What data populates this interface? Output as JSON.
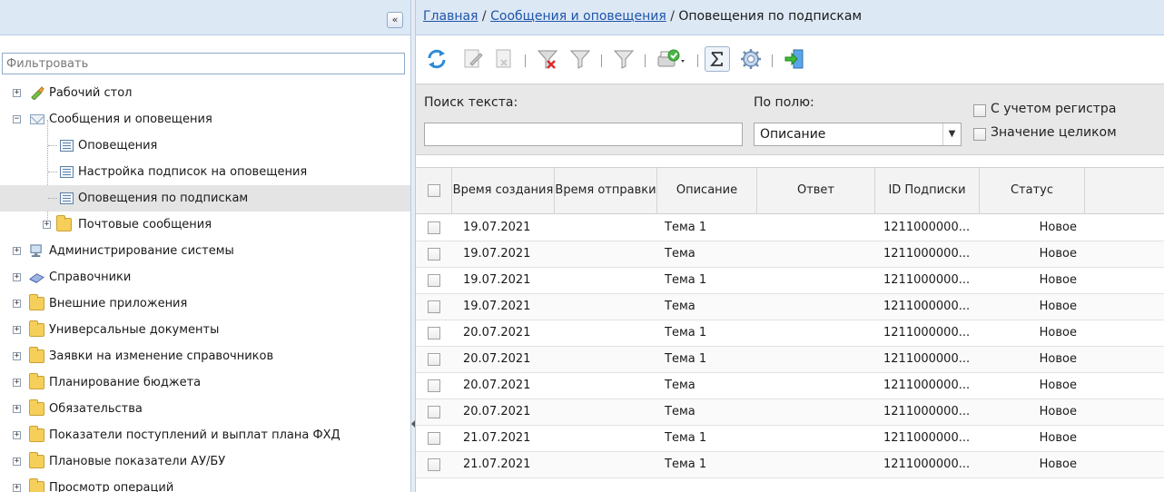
{
  "left_panel": {
    "collapse_label": "«",
    "filter_placeholder": "Фильтровать",
    "tree": [
      {
        "label": "Рабочий стол",
        "icon": "desktop-broom-icon",
        "expander": "+"
      },
      {
        "label": "Сообщения и оповещения",
        "icon": "envelope-icon",
        "expander": "−"
      },
      {
        "label": "Оповещения",
        "icon": "list-icon"
      },
      {
        "label": "Настройка подписок на оповещения",
        "icon": "list-icon"
      },
      {
        "label": "Оповещения по подпискам",
        "icon": "list-icon",
        "selected": true
      },
      {
        "label": "Почтовые сообщения",
        "icon": "folder-icon",
        "expander": "+"
      },
      {
        "label": "Администрирование системы",
        "icon": "computer-icon",
        "expander": "+"
      },
      {
        "label": "Справочники",
        "icon": "books-icon",
        "expander": "+"
      },
      {
        "label": "Внешние приложения",
        "icon": "folder-icon",
        "expander": "+"
      },
      {
        "label": "Универсальные документы",
        "icon": "folder-icon",
        "expander": "+"
      },
      {
        "label": "Заявки на изменение справочников",
        "icon": "folder-icon",
        "expander": "+"
      },
      {
        "label": "Планирование бюджета",
        "icon": "folder-icon",
        "expander": "+"
      },
      {
        "label": "Обязательства",
        "icon": "folder-icon",
        "expander": "+"
      },
      {
        "label": "Показатели поступлений и выплат плана ФХД",
        "icon": "folder-icon",
        "expander": "+"
      },
      {
        "label": "Плановые показатели АУ/БУ",
        "icon": "folder-icon",
        "expander": "+"
      },
      {
        "label": "Просмотр операций",
        "icon": "folder-icon",
        "expander": "+"
      }
    ]
  },
  "breadcrumb": {
    "home": "Главная",
    "sep1": " / ",
    "section": "Сообщения и оповещения",
    "sep2": " / ",
    "current": "Оповещения по подпискам"
  },
  "toolbar": {
    "buttons": [
      "refresh-icon",
      "edit-icon",
      "delete-icon",
      "clear-filter-icon",
      "filter-icon",
      "filter-funnel-icon",
      "check-dropdown-icon",
      "sum-icon",
      "settings-gear-icon",
      "exit-icon"
    ]
  },
  "search": {
    "text_label": "Поиск текста:",
    "text_value": "",
    "field_label": "По полю:",
    "field_value": "Описание",
    "case_label": "С учетом регистра",
    "whole_label": "Значение целиком"
  },
  "table": {
    "columns": [
      "Время создания",
      "Время отправки",
      "Описание",
      "Ответ",
      "ID Подписки",
      "Статус"
    ],
    "rows": [
      {
        "created": "19.07.2021",
        "sent": "",
        "desc": "Тема 1",
        "answer": "",
        "sub_id": "1211000000...",
        "status": "Новое"
      },
      {
        "created": "19.07.2021",
        "sent": "",
        "desc": "Тема",
        "answer": "",
        "sub_id": "1211000000...",
        "status": "Новое"
      },
      {
        "created": "19.07.2021",
        "sent": "",
        "desc": "Тема 1",
        "answer": "",
        "sub_id": "1211000000...",
        "status": "Новое"
      },
      {
        "created": "19.07.2021",
        "sent": "",
        "desc": "Тема",
        "answer": "",
        "sub_id": "1211000000...",
        "status": "Новое"
      },
      {
        "created": "20.07.2021",
        "sent": "",
        "desc": "Тема 1",
        "answer": "",
        "sub_id": "1211000000...",
        "status": "Новое"
      },
      {
        "created": "20.07.2021",
        "sent": "",
        "desc": "Тема 1",
        "answer": "",
        "sub_id": "1211000000...",
        "status": "Новое"
      },
      {
        "created": "20.07.2021",
        "sent": "",
        "desc": "Тема",
        "answer": "",
        "sub_id": "1211000000...",
        "status": "Новое"
      },
      {
        "created": "20.07.2021",
        "sent": "",
        "desc": "Тема",
        "answer": "",
        "sub_id": "1211000000...",
        "status": "Новое"
      },
      {
        "created": "21.07.2021",
        "sent": "",
        "desc": "Тема 1",
        "answer": "",
        "sub_id": "1211000000...",
        "status": "Новое"
      },
      {
        "created": "21.07.2021",
        "sent": "",
        "desc": "Тема 1",
        "answer": "",
        "sub_id": "1211000000...",
        "status": "Новое"
      }
    ]
  },
  "colors": {
    "header_bg": "#dde8f5",
    "link": "#1f55a8",
    "selected_row": "#e4e4e4",
    "folder": "#f5cf5a"
  }
}
